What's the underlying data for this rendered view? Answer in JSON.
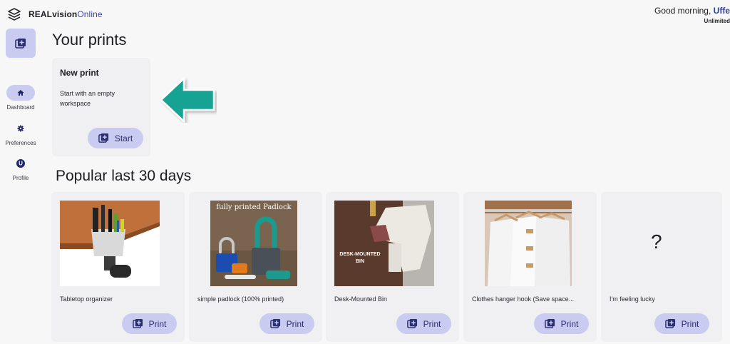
{
  "brand": {
    "name_bold": "REALvision",
    "name_light": "Online"
  },
  "greeting": {
    "text": "Good morning, ",
    "user": "Uffe",
    "plan": "Unlimited"
  },
  "sidebar": {
    "items": [
      {
        "label": "Dashboard",
        "icon": "home-icon",
        "active": true
      },
      {
        "label": "Preferences",
        "icon": "gear-icon",
        "active": false
      },
      {
        "label": "Profile",
        "icon": "user-icon",
        "active": false,
        "avatar_letter": "U"
      }
    ]
  },
  "your_prints": {
    "title": "Your prints",
    "new_print": {
      "title": "New print",
      "description": "Start with an empty workspace",
      "button": "Start"
    }
  },
  "popular": {
    "title": "Popular last 30 days",
    "items": [
      {
        "name": "Tabletop organizer",
        "button": "Print"
      },
      {
        "name": "simple padlock (100% printed)",
        "button": "Print",
        "image_caption": "fully printed Padlock"
      },
      {
        "name": "Desk-Mounted Bin",
        "button": "Print",
        "image_caption": "DESK-MOUNTED BIN"
      },
      {
        "name": "Clothes hanger hook  (Save space...",
        "button": "Print"
      },
      {
        "name": "I'm feeling lucky",
        "button": "Print",
        "placeholder": "?"
      }
    ]
  },
  "colors": {
    "accent": "#c9cbf0",
    "accent_text": "#2c2f6e",
    "arrow": "#12a393",
    "brand_blue": "#2f3fa8"
  }
}
